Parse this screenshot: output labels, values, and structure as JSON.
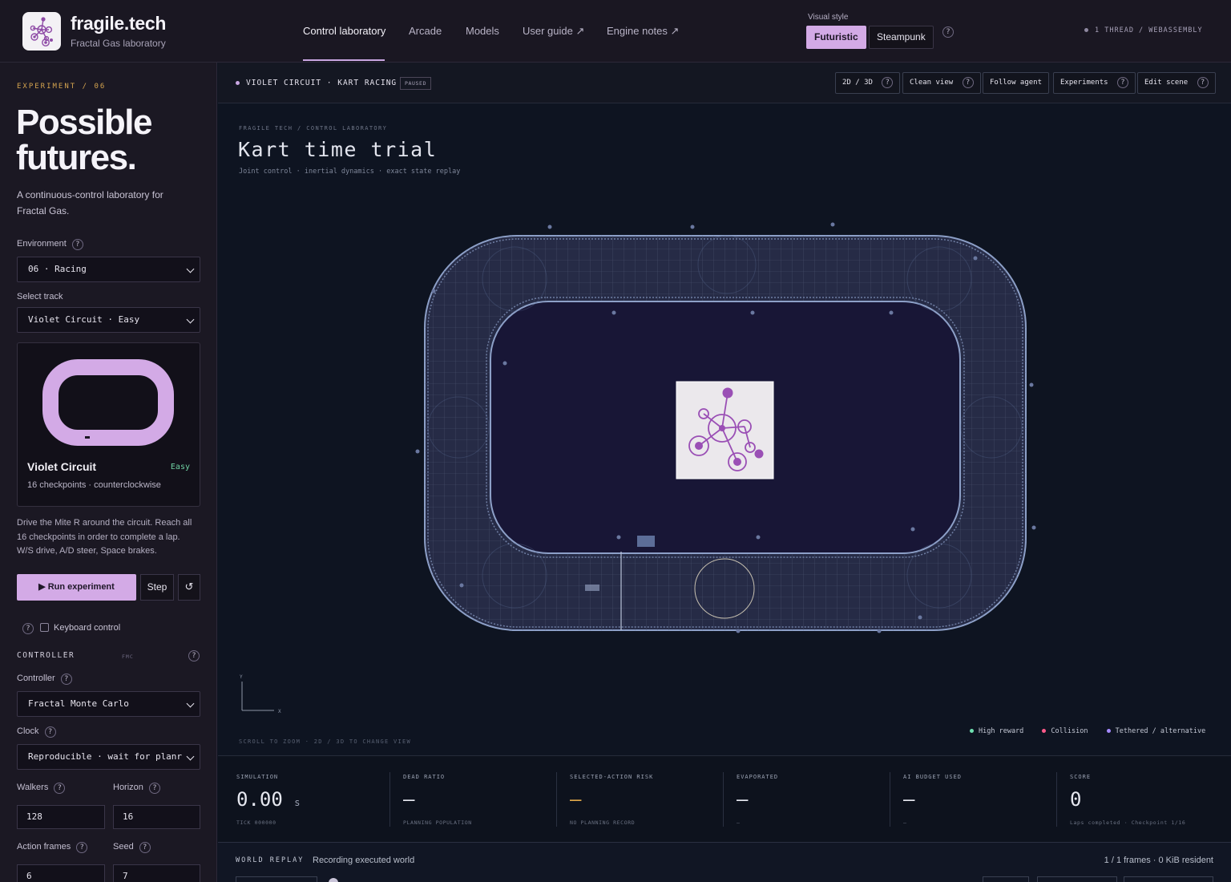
{
  "brand": {
    "title": "fragile.tech",
    "subtitle": "Fractal Gas laboratory",
    "logo_icon": "molecule-logo-icon"
  },
  "nav": {
    "items": [
      {
        "label": "Control laboratory",
        "active": true
      },
      {
        "label": "Arcade"
      },
      {
        "label": "Models"
      },
      {
        "label": "User guide ↗"
      },
      {
        "label": "Engine notes ↗"
      }
    ]
  },
  "visual_style": {
    "label": "Visual style",
    "options": [
      "Futuristic",
      "Steampunk"
    ],
    "selected": "Futuristic",
    "help": "?"
  },
  "thread_info": "1 THREAD / WEBASSEMBLY",
  "sidebar": {
    "experiment_label": "EXPERIMENT / 06",
    "hero_title_line1": "Possible",
    "hero_title_line2": "futures.",
    "hero_desc": "A continuous-control laboratory for Fractal Gas.",
    "environment_label": "Environment",
    "environment_value": "06 · Racing",
    "track_label": "Select track",
    "track_value": "Violet Circuit · Easy",
    "card": {
      "name": "Violet Circuit",
      "difficulty": "Easy",
      "info": "16 checkpoints · counterclockwise"
    },
    "track_desc": "Drive the Mite R around the circuit. Reach all 16 checkpoints in order to complete a lap. W/S drive, A/D steer, Space brakes.",
    "run_label": "▶ Run experiment",
    "step_label": "Step",
    "reset_label": "↺",
    "keyboard_label": "Keyboard control",
    "controller_heading": "CONTROLLER",
    "controller_tag": "FMC",
    "controller_label": "Controller",
    "controller_value": "Fractal Monte Carlo",
    "clock_label": "Clock",
    "clock_value": "Reproducible · wait for planr",
    "walkers_label": "Walkers",
    "walkers_value": "128",
    "horizon_label": "Horizon",
    "horizon_value": "16",
    "action_frames_label": "Action frames",
    "action_frames_value": "6",
    "seed_label": "Seed",
    "seed_value": "7",
    "help": "?"
  },
  "toolbar": {
    "scene_title": "VIOLET CIRCUIT · KART RACING",
    "status_badge": "PAUSED",
    "buttons": [
      "2D / 3D",
      "Clean view",
      "Follow agent",
      "Experiments",
      "Edit scene"
    ]
  },
  "scene": {
    "breadcrumb": "FRAGILE TECH / CONTROL LABORATORY",
    "title": "Kart time trial",
    "subtitle": "Joint control · inertial dynamics · exact state replay",
    "axis_x": "X",
    "axis_y": "Y",
    "hint": "SCROLL TO ZOOM · 2D / 3D TO CHANGE VIEW",
    "legend": [
      {
        "label": "High reward",
        "color": "#6fe0b0"
      },
      {
        "label": "Collision",
        "color": "#ff5a8a"
      },
      {
        "label": "Tethered / alternative",
        "color": "#a58aff"
      }
    ]
  },
  "stats": [
    {
      "label": "SIMULATION",
      "value": "0.00",
      "unit": "s",
      "foot": "TICK 000000"
    },
    {
      "label": "DEAD RATIO",
      "value": "—",
      "foot": "PLANNING POPULATION"
    },
    {
      "label": "SELECTED-ACTION RISK",
      "value": "—",
      "foot": "NO PLANNING RECORD",
      "accent": "#e0a84a"
    },
    {
      "label": "EVAPORATED",
      "value": "—",
      "foot": "—"
    },
    {
      "label": "AI BUDGET USED",
      "value": "—",
      "foot": "—"
    },
    {
      "label": "SCORE",
      "value": "0",
      "foot": "Laps completed · Checkpoint 1/16"
    }
  ],
  "replay": {
    "label": "WORLD REPLAY",
    "status": "Recording executed world",
    "frames": "1 / 1 frames · 0 KiB resident"
  },
  "colors": {
    "accent": "#d3aae6",
    "easy": "#6fd0a2",
    "warning": "#d3a24f"
  }
}
